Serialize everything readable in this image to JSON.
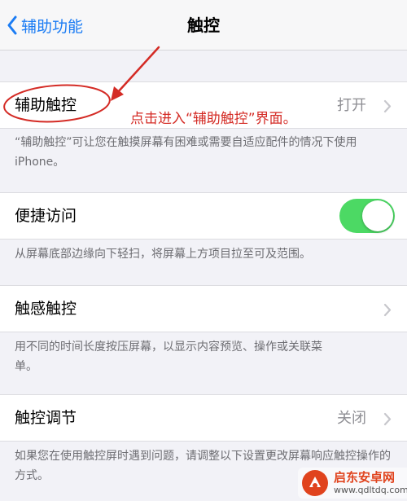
{
  "navbar": {
    "back_label": "辅助功能",
    "title": "触控"
  },
  "assistive_touch": {
    "label": "辅助触控",
    "value": "打开",
    "footer": "“辅助触控”可让您在触摸屏幕有困难或需要自适应配件的情况下使用iPhone。"
  },
  "annotation": {
    "hint": "点击进入“辅助触控”界面。",
    "color": "#d42b25"
  },
  "reachability": {
    "label": "便捷访问",
    "enabled": true,
    "footer": "从屏幕底部边缘向下轻扫，将屏幕上方项目拉至可及范围。"
  },
  "haptic_touch": {
    "label": "触感触控",
    "footer": "用不同的时间长度按压屏幕，以显示内容预览、操作或关联菜单。"
  },
  "touch_accommodations": {
    "label": "触控调节",
    "value": "关闭",
    "footer": "如果您在使用触控屏时遇到问题，请调整以下设置更改屏幕响应触控操作的方式。"
  },
  "watermark": {
    "name": "启东安卓网",
    "url": "www.qdltdq.com"
  },
  "colors": {
    "accent": "#1b7cf4",
    "toggle_on": "#4cd964",
    "background": "#f2f2f7"
  }
}
